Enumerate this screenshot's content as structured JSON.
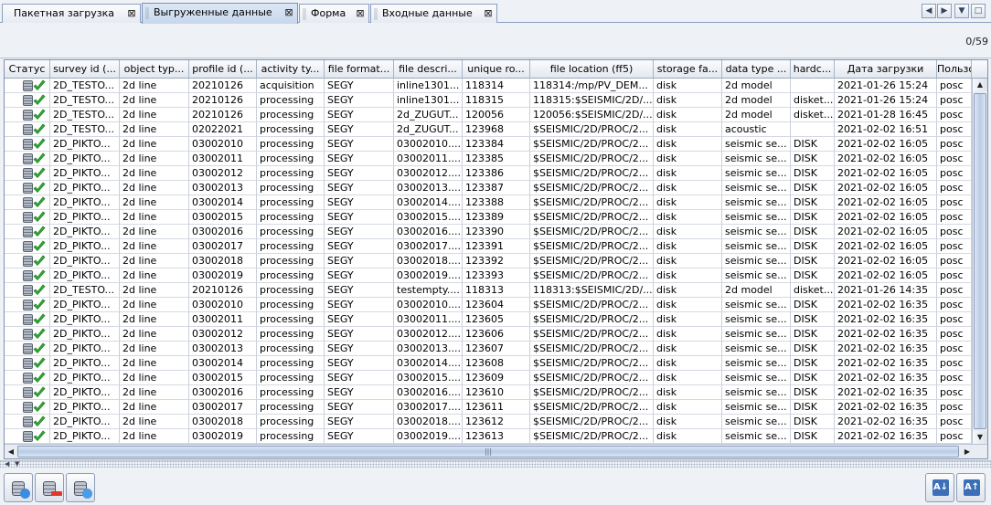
{
  "tabs": [
    {
      "label": "Пакетная загрузка",
      "close": "⊠"
    },
    {
      "label": "Выгруженные данные",
      "close": "⊠"
    },
    {
      "label": "Форма",
      "close": "⊠"
    },
    {
      "label": "Входные данные",
      "close": "⊠"
    }
  ],
  "tab_nav": {
    "prev": "◀",
    "next": "▶",
    "menu": "▼",
    "maximize": "□"
  },
  "counter": "0/59",
  "columns": [
    "Статус",
    "survey id (...",
    "object typ...",
    "profile id (...",
    "activity ty...",
    "file format...",
    "file descri...",
    "unique ro...",
    "file location (ff5)",
    "storage fa...",
    "data type ...",
    "hardc...",
    "Дата загрузки",
    "Пользо"
  ],
  "rows": [
    [
      "2D_TESTO...",
      "2d line",
      "20210126",
      "acquisition",
      "SEGY",
      "inline1301...",
      "118314",
      "118314:/mp/PV_DEM...",
      "disk",
      "2d model",
      "",
      "2021-01-26 15:24",
      "posc"
    ],
    [
      "2D_TESTO...",
      "2d line",
      "20210126",
      "processing",
      "SEGY",
      "inline1301...",
      "118315",
      "118315:$SEISMIC/2D/...",
      "disk",
      "2d model",
      "disket...",
      "2021-01-26 15:24",
      "posc"
    ],
    [
      "2D_TESTO...",
      "2d line",
      "20210126",
      "processing",
      "SEGY",
      "2d_ZUGUT...",
      "120056",
      "120056:$SEISMIC/2D/...",
      "disk",
      "2d model",
      "disket...",
      "2021-01-28 16:45",
      "posc"
    ],
    [
      "2D_TESTO...",
      "2d line",
      "02022021",
      "processing",
      "SEGY",
      "2d_ZUGUT...",
      "123968",
      "$SEISMIC/2D/PROC/2...",
      "disk",
      "acoustic",
      "",
      "2021-02-02 16:51",
      "posc"
    ],
    [
      "2D_PIKTO...",
      "2d line",
      "03002010",
      "processing",
      "SEGY",
      "03002010....",
      "123384",
      "$SEISMIC/2D/PROC/2...",
      "disk",
      "seismic se...",
      "DISK",
      "2021-02-02 16:05",
      "posc"
    ],
    [
      "2D_PIKTO...",
      "2d line",
      "03002011",
      "processing",
      "SEGY",
      "03002011....",
      "123385",
      "$SEISMIC/2D/PROC/2...",
      "disk",
      "seismic se...",
      "DISK",
      "2021-02-02 16:05",
      "posc"
    ],
    [
      "2D_PIKTO...",
      "2d line",
      "03002012",
      "processing",
      "SEGY",
      "03002012....",
      "123386",
      "$SEISMIC/2D/PROC/2...",
      "disk",
      "seismic se...",
      "DISK",
      "2021-02-02 16:05",
      "posc"
    ],
    [
      "2D_PIKTO...",
      "2d line",
      "03002013",
      "processing",
      "SEGY",
      "03002013....",
      "123387",
      "$SEISMIC/2D/PROC/2...",
      "disk",
      "seismic se...",
      "DISK",
      "2021-02-02 16:05",
      "posc"
    ],
    [
      "2D_PIKTO...",
      "2d line",
      "03002014",
      "processing",
      "SEGY",
      "03002014....",
      "123388",
      "$SEISMIC/2D/PROC/2...",
      "disk",
      "seismic se...",
      "DISK",
      "2021-02-02 16:05",
      "posc"
    ],
    [
      "2D_PIKTO...",
      "2d line",
      "03002015",
      "processing",
      "SEGY",
      "03002015....",
      "123389",
      "$SEISMIC/2D/PROC/2...",
      "disk",
      "seismic se...",
      "DISK",
      "2021-02-02 16:05",
      "posc"
    ],
    [
      "2D_PIKTO...",
      "2d line",
      "03002016",
      "processing",
      "SEGY",
      "03002016....",
      "123390",
      "$SEISMIC/2D/PROC/2...",
      "disk",
      "seismic se...",
      "DISK",
      "2021-02-02 16:05",
      "posc"
    ],
    [
      "2D_PIKTO...",
      "2d line",
      "03002017",
      "processing",
      "SEGY",
      "03002017....",
      "123391",
      "$SEISMIC/2D/PROC/2...",
      "disk",
      "seismic se...",
      "DISK",
      "2021-02-02 16:05",
      "posc"
    ],
    [
      "2D_PIKTO...",
      "2d line",
      "03002018",
      "processing",
      "SEGY",
      "03002018....",
      "123392",
      "$SEISMIC/2D/PROC/2...",
      "disk",
      "seismic se...",
      "DISK",
      "2021-02-02 16:05",
      "posc"
    ],
    [
      "2D_PIKTO...",
      "2d line",
      "03002019",
      "processing",
      "SEGY",
      "03002019....",
      "123393",
      "$SEISMIC/2D/PROC/2...",
      "disk",
      "seismic se...",
      "DISK",
      "2021-02-02 16:05",
      "posc"
    ],
    [
      "2D_TESTO...",
      "2d line",
      "20210126",
      "processing",
      "SEGY",
      "testempty....",
      "118313",
      "118313:$SEISMIC/2D/...",
      "disk",
      "2d model",
      "disket...",
      "2021-01-26 14:35",
      "posc"
    ],
    [
      "2D_PIKTO...",
      "2d line",
      "03002010",
      "processing",
      "SEGY",
      "03002010....",
      "123604",
      "$SEISMIC/2D/PROC/2...",
      "disk",
      "seismic se...",
      "DISK",
      "2021-02-02 16:35",
      "posc"
    ],
    [
      "2D_PIKTO...",
      "2d line",
      "03002011",
      "processing",
      "SEGY",
      "03002011....",
      "123605",
      "$SEISMIC/2D/PROC/2...",
      "disk",
      "seismic se...",
      "DISK",
      "2021-02-02 16:35",
      "posc"
    ],
    [
      "2D_PIKTO...",
      "2d line",
      "03002012",
      "processing",
      "SEGY",
      "03002012....",
      "123606",
      "$SEISMIC/2D/PROC/2...",
      "disk",
      "seismic se...",
      "DISK",
      "2021-02-02 16:35",
      "posc"
    ],
    [
      "2D_PIKTO...",
      "2d line",
      "03002013",
      "processing",
      "SEGY",
      "03002013....",
      "123607",
      "$SEISMIC/2D/PROC/2...",
      "disk",
      "seismic se...",
      "DISK",
      "2021-02-02 16:35",
      "posc"
    ],
    [
      "2D_PIKTO...",
      "2d line",
      "03002014",
      "processing",
      "SEGY",
      "03002014....",
      "123608",
      "$SEISMIC/2D/PROC/2...",
      "disk",
      "seismic se...",
      "DISK",
      "2021-02-02 16:35",
      "posc"
    ],
    [
      "2D_PIKTO...",
      "2d line",
      "03002015",
      "processing",
      "SEGY",
      "03002015....",
      "123609",
      "$SEISMIC/2D/PROC/2...",
      "disk",
      "seismic se...",
      "DISK",
      "2021-02-02 16:35",
      "posc"
    ],
    [
      "2D_PIKTO...",
      "2d line",
      "03002016",
      "processing",
      "SEGY",
      "03002016....",
      "123610",
      "$SEISMIC/2D/PROC/2...",
      "disk",
      "seismic se...",
      "DISK",
      "2021-02-02 16:35",
      "posc"
    ],
    [
      "2D_PIKTO...",
      "2d line",
      "03002017",
      "processing",
      "SEGY",
      "03002017....",
      "123611",
      "$SEISMIC/2D/PROC/2...",
      "disk",
      "seismic se...",
      "DISK",
      "2021-02-02 16:35",
      "posc"
    ],
    [
      "2D_PIKTO...",
      "2d line",
      "03002018",
      "processing",
      "SEGY",
      "03002018....",
      "123612",
      "$SEISMIC/2D/PROC/2...",
      "disk",
      "seismic se...",
      "DISK",
      "2021-02-02 16:35",
      "posc"
    ],
    [
      "2D_PIKTO...",
      "2d line",
      "03002019",
      "processing",
      "SEGY",
      "03002019....",
      "123613",
      "$SEISMIC/2D/PROC/2...",
      "disk",
      "seismic se...",
      "DISK",
      "2021-02-02 16:35",
      "posc"
    ]
  ],
  "status_icon": {
    "db": "database-icon",
    "ok": "check-icon"
  },
  "scroll": {
    "up": "▲",
    "down": "▼",
    "left": "◀",
    "right": "▶",
    "grip": "|||"
  },
  "splitter": {
    "left": "◀",
    "down": "▼"
  },
  "bottom_buttons": [
    {
      "icon": "add-database-icon"
    },
    {
      "icon": "remove-database-icon"
    },
    {
      "icon": "refresh-database-icon"
    },
    {
      "icon": "sort-az-icon",
      "label": "A↓"
    },
    {
      "icon": "sort-az-icon",
      "label": "A↑"
    }
  ],
  "colors": {
    "check": "#2fae33",
    "accent": "#c6d7ec"
  }
}
